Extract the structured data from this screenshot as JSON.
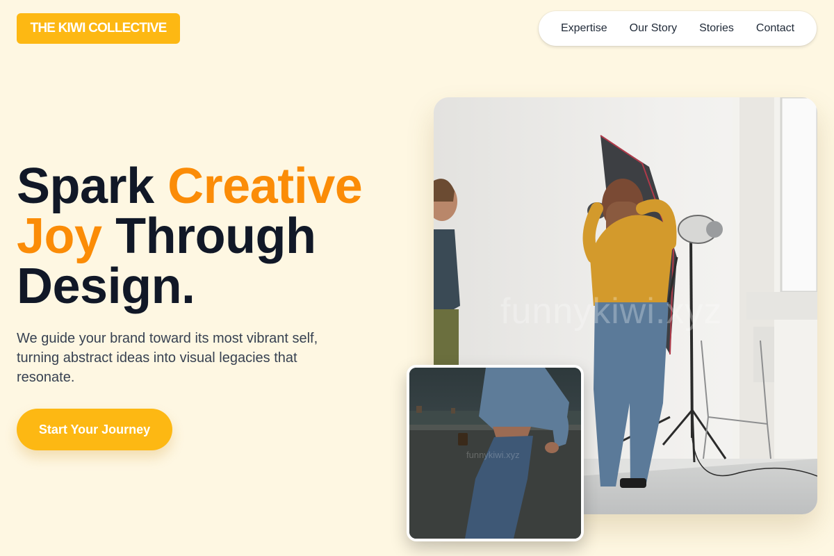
{
  "brand": {
    "logo_text": "THE KIWI COLLECTIVE"
  },
  "nav": {
    "items": [
      {
        "label": "Expertise"
      },
      {
        "label": "Our Story"
      },
      {
        "label": "Stories"
      },
      {
        "label": "Contact"
      }
    ]
  },
  "hero": {
    "title_word1": "Spark ",
    "title_accent1": "Creative",
    "title_accent2": "Joy",
    "title_word2": " Through",
    "title_word3": "Design.",
    "subtitle": "We guide your brand toward its most vibrant self, turning abstract ideas into visual legacies that resonate.",
    "cta_label": "Start Your Journey"
  },
  "media": {
    "main_watermark": "funnykiwi.xyz",
    "small_watermark": "funnykiwi.xyz"
  },
  "colors": {
    "background": "#fef7e2",
    "brand_yellow": "#fdb813",
    "accent_orange": "#fb8c07",
    "heading": "#111827"
  }
}
